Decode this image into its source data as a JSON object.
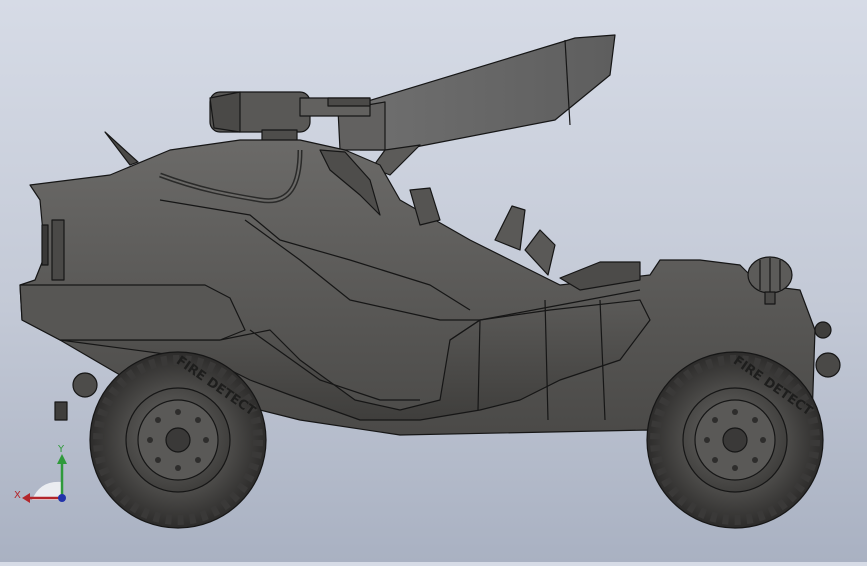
{
  "viewport": {
    "background_top": "#d6dbe6",
    "background_bottom": "#a9b1c2",
    "model": {
      "type": "armored-buggy-with-turret",
      "body_color": "#5a5957",
      "edge_color": "#161616",
      "tire_text": "FIRE DETECT"
    }
  },
  "triad": {
    "x_label": "X",
    "y_label": "Y",
    "x_color": "#b3262b",
    "y_color": "#2f9a3b",
    "z_color": "#2233aa"
  }
}
